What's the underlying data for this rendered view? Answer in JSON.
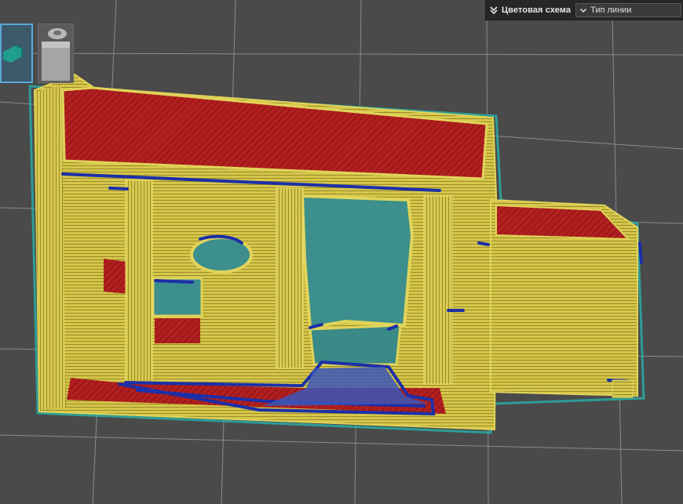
{
  "legend_panel": {
    "title": "Цветовая схема",
    "selected_scheme": "Тип линии",
    "collapse_icon": "double-chevron-down-icon",
    "dropdown_icon": "chevron-down-icon"
  },
  "object_list": [
    {
      "name": "teal-part-thumbnail",
      "selected": true,
      "color": "#1f9e8c"
    },
    {
      "name": "grey-part-thumbnail",
      "selected": false,
      "color": "#9a9a9a"
    }
  ],
  "colors": {
    "background": "#4a4a4a",
    "grid": "#8a8a8a",
    "perimeter": "#d6c64a",
    "infill": "#b31f1f",
    "support": "#1c2fa8",
    "skirt": "#2aa6a0"
  }
}
